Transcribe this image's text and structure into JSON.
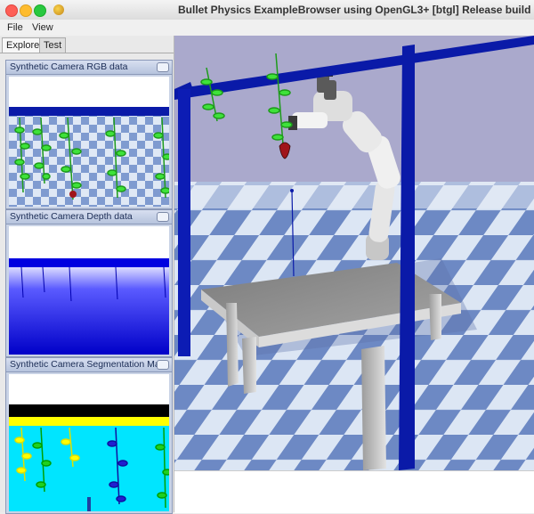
{
  "window": {
    "title": "Bullet Physics ExampleBrowser using OpenGL3+ [btgl] Release build"
  },
  "menu": {
    "items": [
      "File",
      "View"
    ]
  },
  "tabs": [
    {
      "label": "Explorer",
      "active": true
    },
    {
      "label": "Test",
      "active": false
    }
  ],
  "camera_panels": {
    "rgb": {
      "title": "Synthetic Camera RGB data"
    },
    "depth": {
      "title": "Synthetic Camera Depth data"
    },
    "segmentation": {
      "title": "Synthetic Camera Segmentation Mask"
    }
  },
  "colors": {
    "sky": "#aaa9cc",
    "frame_blue": "#0a1aa8",
    "floor_light": "#dce6f4",
    "floor_dark": "#6d89c4",
    "table_top": "#8a8a8a",
    "leaf_green": "#2fc92a",
    "seg_cyan": "#00e5ff",
    "seg_yellow": "#ffff00",
    "depth_blue": "#0000ff"
  }
}
